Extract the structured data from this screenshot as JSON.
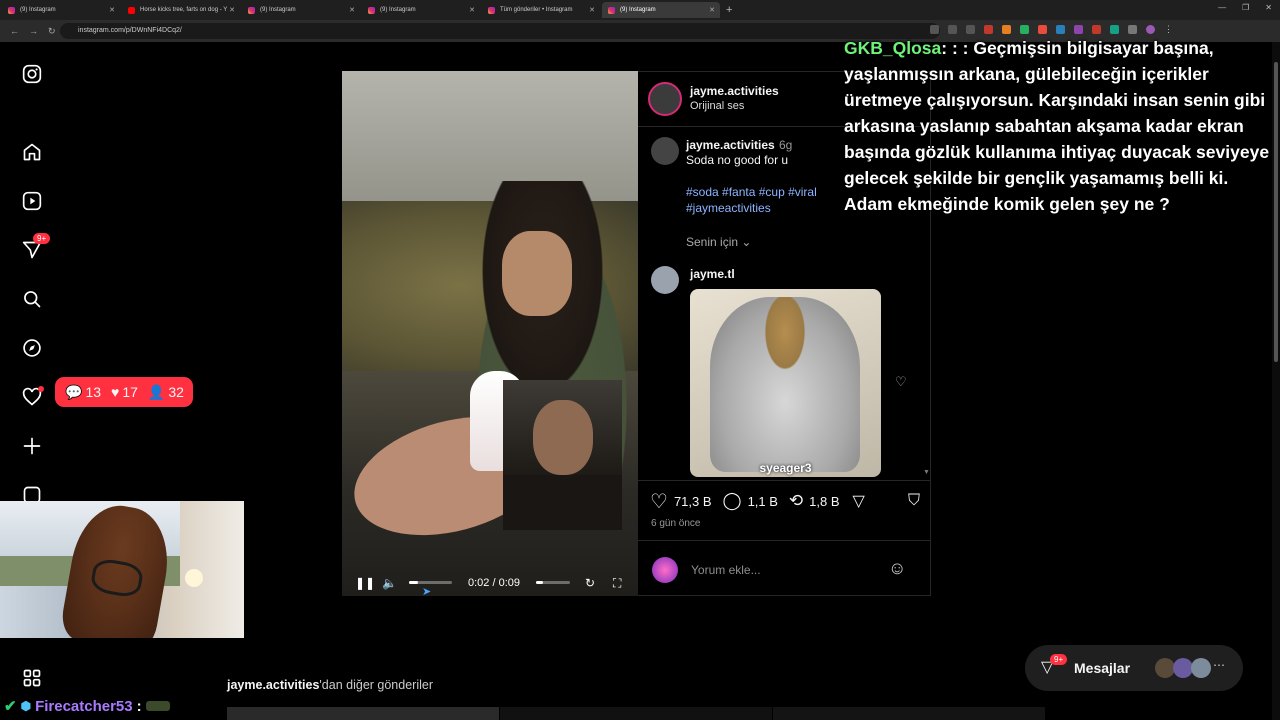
{
  "browser": {
    "tabs": [
      {
        "label": "(9) Instagram",
        "active": false,
        "favicon": "instagram"
      },
      {
        "label": "Horse kicks tree, farts on dog - Y",
        "active": false,
        "favicon": "youtube"
      },
      {
        "label": "(9) Instagram",
        "active": false,
        "favicon": "instagram"
      },
      {
        "label": "(9) Instagram",
        "active": false,
        "favicon": "instagram"
      },
      {
        "label": "Tüm gönderiler • Instagram",
        "active": false,
        "favicon": "instagram"
      },
      {
        "label": "(9) Instagram",
        "active": true,
        "favicon": "instagram"
      }
    ],
    "url": "instagram.com/p/DWnNFi4DCq2/"
  },
  "sidebar": {
    "messages_badge": "9+",
    "notifications": {
      "comments": "13",
      "likes": "17",
      "follows": "32"
    }
  },
  "post": {
    "author": "jayme.activities",
    "audio": "Orijinal ses",
    "caption_author": "jayme.activities",
    "caption_age": "6g",
    "caption": "Soda no good for u",
    "hashtags_line1": "#soda #fanta #cup #viral",
    "hashtags_line2": "#jaymeactivities",
    "for_you": "Senin için",
    "comment_author": "jayme.tl",
    "comment_image_caption": "syeager3",
    "likes": "71,3 B",
    "comments": "1,1 B",
    "reposts": "1,8 B",
    "posted": "6 gün önce",
    "add_comment_placeholder": "Yorum ekle...",
    "video_time": "0:02 / 0:09",
    "video_progress": 0.22,
    "volume_level": 0.2
  },
  "more_posts": {
    "author": "jayme.activities",
    "suffix": "'dan diğer gönderiler"
  },
  "messages_pill": {
    "label": "Mesajlar",
    "badge": "9+"
  },
  "stream_overlay": {
    "chat_name": "GKB_Qlosa",
    "chat_sep": ":",
    "chat_text": ": : Geçmişsin bilgisayar başına, yaşlanmışsın arkana, gülebileceğin içerikler üretmeye çalışıyorsun. Karşındaki insan senin gibi arkasına yaslanıp sabahtan akşama kadar ekran başında gözlük kullanıma ihtiyaç duyacak seviyeye gelecek şekilde bir gençlik yaşamamış belli ki. Adam ekmeğinde komik gelen şey ne ?",
    "bottom_chat_name": "Firecatcher53",
    "bottom_chat_sep": ":"
  },
  "colors": {
    "accent_red": "#ff3040",
    "hashtag_blue": "#8cb4ff",
    "chat_green": "#6ef27a",
    "chat_purple": "#a97bff"
  }
}
